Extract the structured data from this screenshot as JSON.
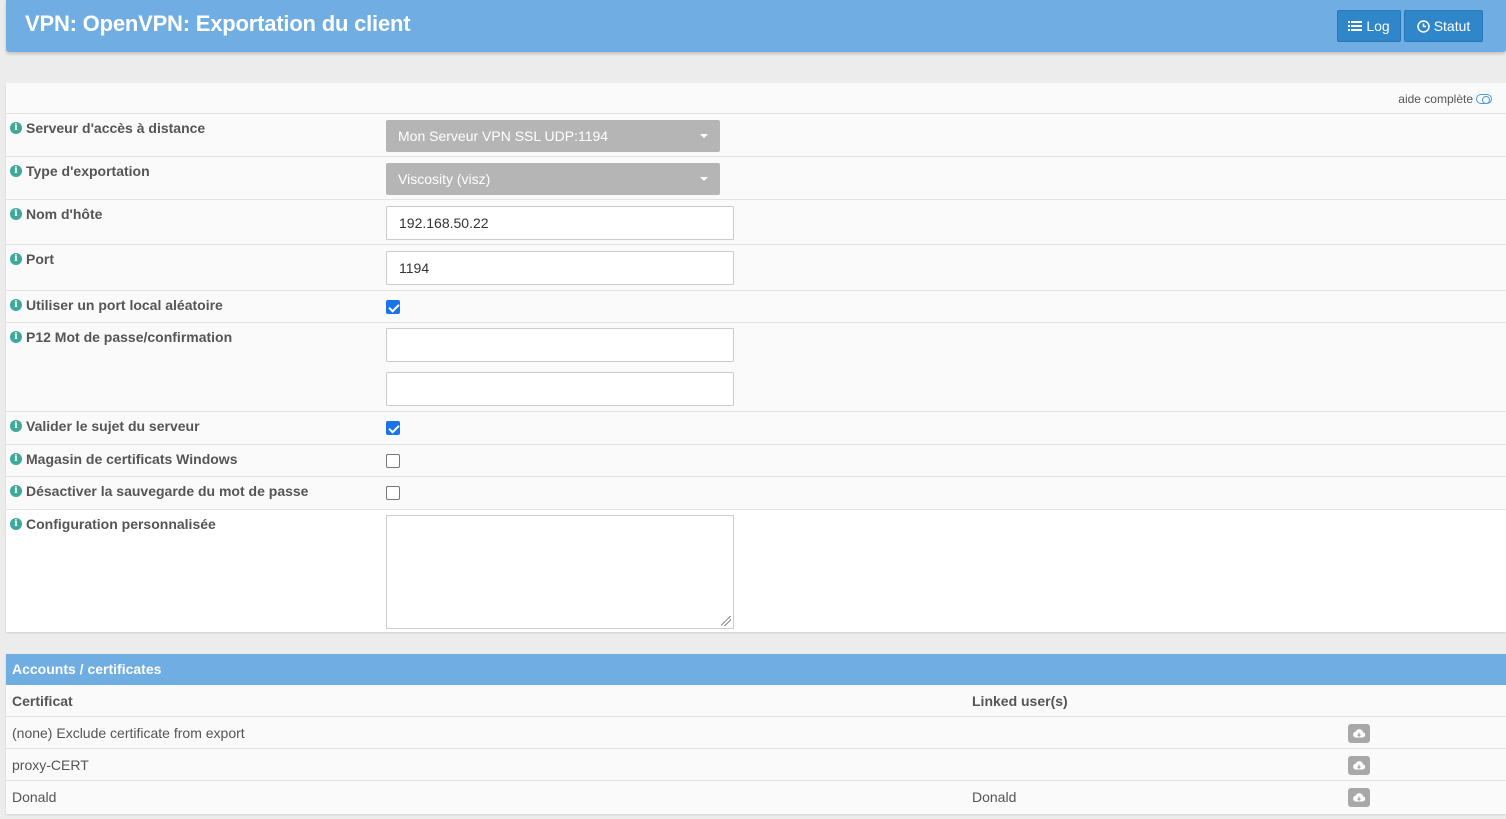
{
  "header": {
    "title": "VPN: OpenVPN: Exportation du client",
    "log_label": "Log",
    "statut_label": "Statut"
  },
  "form": {
    "aide_label": "aide complète",
    "fields": {
      "server": {
        "label": "Serveur d'accès à distance",
        "value": "Mon Serveur VPN SSL UDP:1194"
      },
      "export_type": {
        "label": "Type d'exportation",
        "value": "Viscosity (visz)"
      },
      "hostname": {
        "label": "Nom d'hôte",
        "value": "192.168.50.22"
      },
      "port": {
        "label": "Port",
        "value": "1194"
      },
      "random_port": {
        "label": "Utiliser un port local aléatoire",
        "checked": true
      },
      "p12": {
        "label": "P12 Mot de passe/confirmation",
        "value": "",
        "confirm": ""
      },
      "validate_subject": {
        "label": "Valider le sujet du serveur",
        "checked": true
      },
      "windows_store": {
        "label": "Magasin de certificats Windows",
        "checked": false
      },
      "disable_save_pass": {
        "label": "Désactiver la sauvegarde du mot de passe",
        "checked": false
      },
      "custom_config": {
        "label": "Configuration personnalisée",
        "value": ""
      }
    }
  },
  "accounts": {
    "title": "Accounts / certificates",
    "columns": [
      "Certificat",
      "Linked user(s)"
    ],
    "rows": [
      {
        "cert": "(none) Exclude certificate from export",
        "user": ""
      },
      {
        "cert": "proxy-CERT",
        "user": ""
      },
      {
        "cert": "Donald",
        "user": "Donald"
      }
    ]
  },
  "icons": {
    "log": "list-icon",
    "statut": "clock-icon",
    "info": "info-icon",
    "download": "cloud-download-icon"
  },
  "colors": {
    "header_bg": "#6fade3",
    "button_bg": "#2f86c9",
    "info_icon": "#3ea89b",
    "select_bg": "#b5b5b5",
    "checkbox_on": "#1a73e8"
  }
}
